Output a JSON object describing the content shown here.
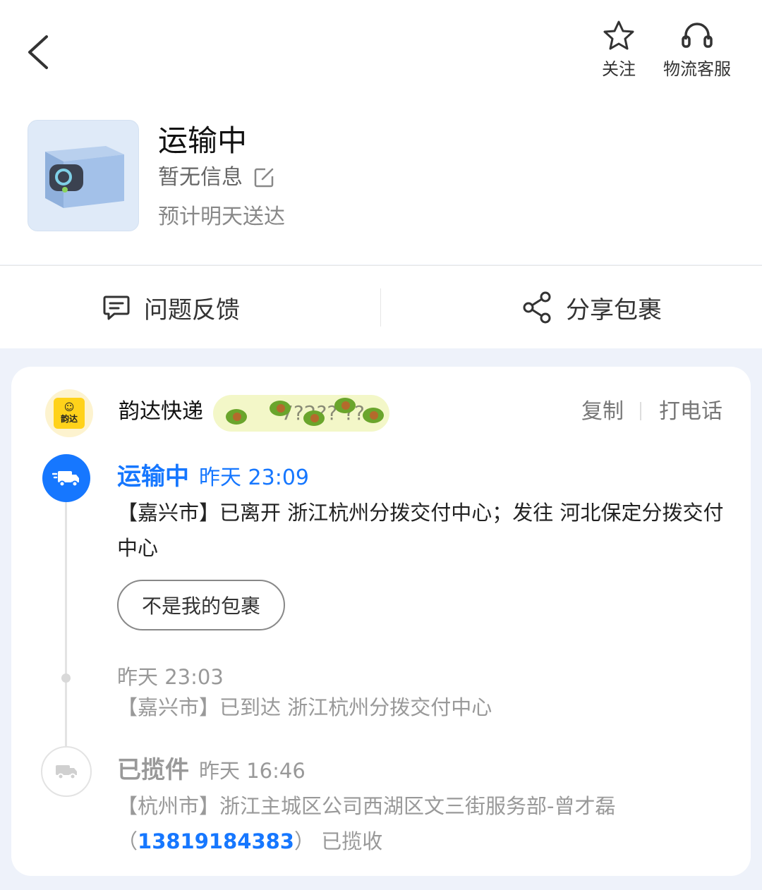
{
  "header": {
    "follow_label": "关注",
    "service_label": "物流客服"
  },
  "package": {
    "status": "运输中",
    "name": "暂无信息",
    "eta": "预计明天送达"
  },
  "actions": {
    "feedback_label": "问题反馈",
    "share_label": "分享包裹"
  },
  "carrier": {
    "name": "韵达快递",
    "logo_text": "韵达",
    "tracking_partial": "7?2?? ??12",
    "copy_label": "复制",
    "call_label": "打电话"
  },
  "events": [
    {
      "status": "运输中",
      "time": "昨天  23:09",
      "desc": "【嘉兴市】已离开 浙江杭州分拨交付中心；发往 河北保定分拨交付中心",
      "action_label": "不是我的包裹"
    },
    {
      "time": "昨天  23:03",
      "desc": "【嘉兴市】已到达 浙江杭州分拨交付中心"
    },
    {
      "status": "已揽件",
      "time": "昨天  16:46",
      "desc_prefix": "【杭州市】浙江主城区公司西湖区文三街服务部-曾才磊（",
      "phone": "13819184383",
      "desc_suffix": "）  已揽收"
    }
  ],
  "colors": {
    "accent": "#1677ff",
    "background": "#eef2fa"
  }
}
